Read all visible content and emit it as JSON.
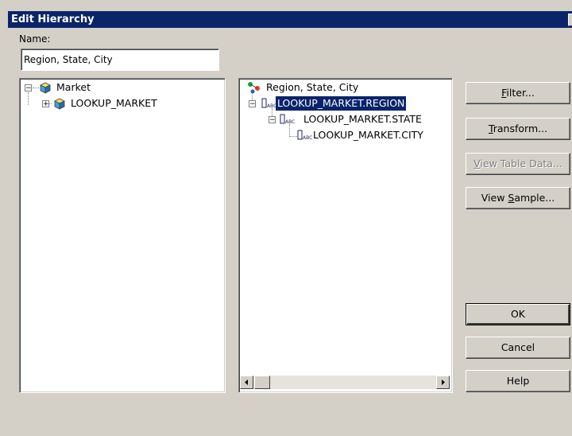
{
  "window": {
    "title": "Edit Hierarchy",
    "close_glyph": "✕"
  },
  "name_field": {
    "label": "Name:",
    "value": "Region, State, City"
  },
  "source_tree": {
    "items": [
      {
        "label": "Market",
        "expander": "−"
      },
      {
        "label": "LOOKUP_MARKET",
        "expander": "+"
      }
    ]
  },
  "hierarchy_tree": {
    "root": "Region, State, City",
    "levels": [
      {
        "label": "LOOKUP_MARKET.REGION",
        "expander": "−",
        "selected": true
      },
      {
        "label": "LOOKUP_MARKET.STATE",
        "expander": "−"
      },
      {
        "label": "LOOKUP_MARKET.CITY"
      }
    ]
  },
  "buttons": {
    "filter": {
      "pre": "",
      "key": "F",
      "post": "ilter..."
    },
    "transform": {
      "pre": "",
      "key": "T",
      "post": "ransform..."
    },
    "view_table_data": {
      "pre": "",
      "key": "V",
      "post": "iew Table Data..."
    },
    "view_sample": {
      "pre": "View ",
      "key": "S",
      "post": "ample..."
    },
    "ok": "OK",
    "cancel": "Cancel",
    "help": "Help"
  },
  "colors": {
    "titlebar": "#0a246a",
    "selection": "#0a246a",
    "face": "#d4d0c8"
  }
}
